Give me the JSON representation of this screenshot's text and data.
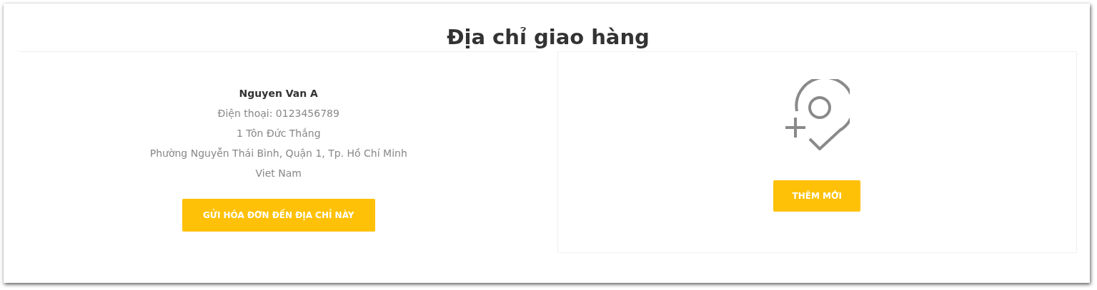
{
  "title": "Địa chỉ giao hàng",
  "address": {
    "name": "Nguyen Van A",
    "lines": [
      "Điện thoại: 0123456789",
      "1 Tôn Đức Thắng",
      "Phường Nguyễn Thái Bình, Quận 1, Tp. Hồ Chí Minh",
      "Viet Nam"
    ],
    "button": "GỬI HÓA ĐƠN ĐẾN ĐỊA CHỈ NÀY"
  },
  "add_new": {
    "button": "THÊM MỚI"
  }
}
